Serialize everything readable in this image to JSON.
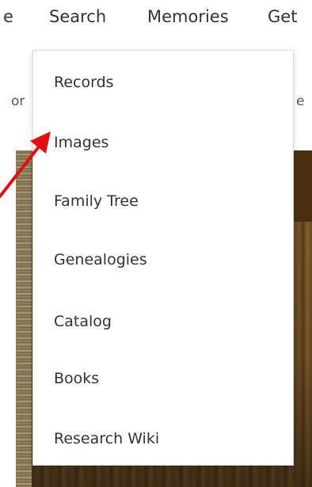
{
  "topnav": {
    "items": [
      {
        "label": "e"
      },
      {
        "label": "Search"
      },
      {
        "label": "Memories"
      },
      {
        "label": "Get"
      }
    ]
  },
  "content": {
    "left_fragment": "or",
    "right_fragment": "e"
  },
  "dropdown": {
    "items": [
      {
        "label": "Records"
      },
      {
        "label": "Images"
      },
      {
        "label": "Family Tree"
      },
      {
        "label": "Genealogies"
      },
      {
        "label": "Catalog"
      },
      {
        "label": "Books"
      },
      {
        "label": "Research Wiki"
      }
    ]
  },
  "annotation": {
    "arrow_color": "#e01010",
    "arrow_target": "Images"
  },
  "colors": {
    "menu_text": "#333333",
    "menu_border": "#dcdcdc"
  }
}
